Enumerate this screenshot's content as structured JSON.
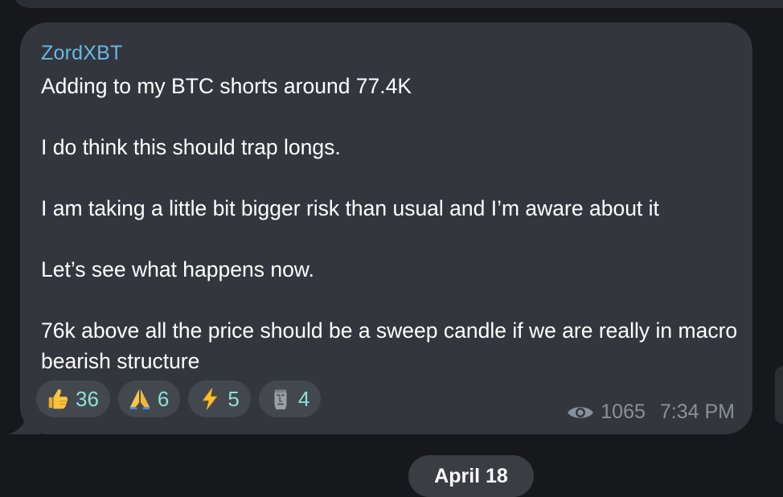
{
  "message": {
    "sender": "ZordXBT",
    "lines": [
      "Adding to my BTC shorts around 77.4K",
      "",
      "I do think this should trap longs.",
      "",
      "I am taking a little bit bigger risk than usual and I’m aware about it",
      "",
      "Let’s see what happens now.",
      "",
      "76k above all the price should be a sweep candle if we are really in macro bearish structure"
    ],
    "reactions": [
      {
        "icon": "thumbs-up-icon",
        "count": "36"
      },
      {
        "icon": "pray-icon",
        "count": "6"
      },
      {
        "icon": "lightning-icon",
        "count": "5"
      },
      {
        "icon": "moai-icon",
        "count": "4"
      }
    ],
    "views": "1065",
    "time": "7:34 PM"
  },
  "date_separator": "April 18",
  "colors": {
    "background": "#17181c",
    "bubble": "#33373d",
    "sender": "#67b8e4",
    "reaction_count": "#8ee0d6",
    "meta": "#8a9099"
  }
}
